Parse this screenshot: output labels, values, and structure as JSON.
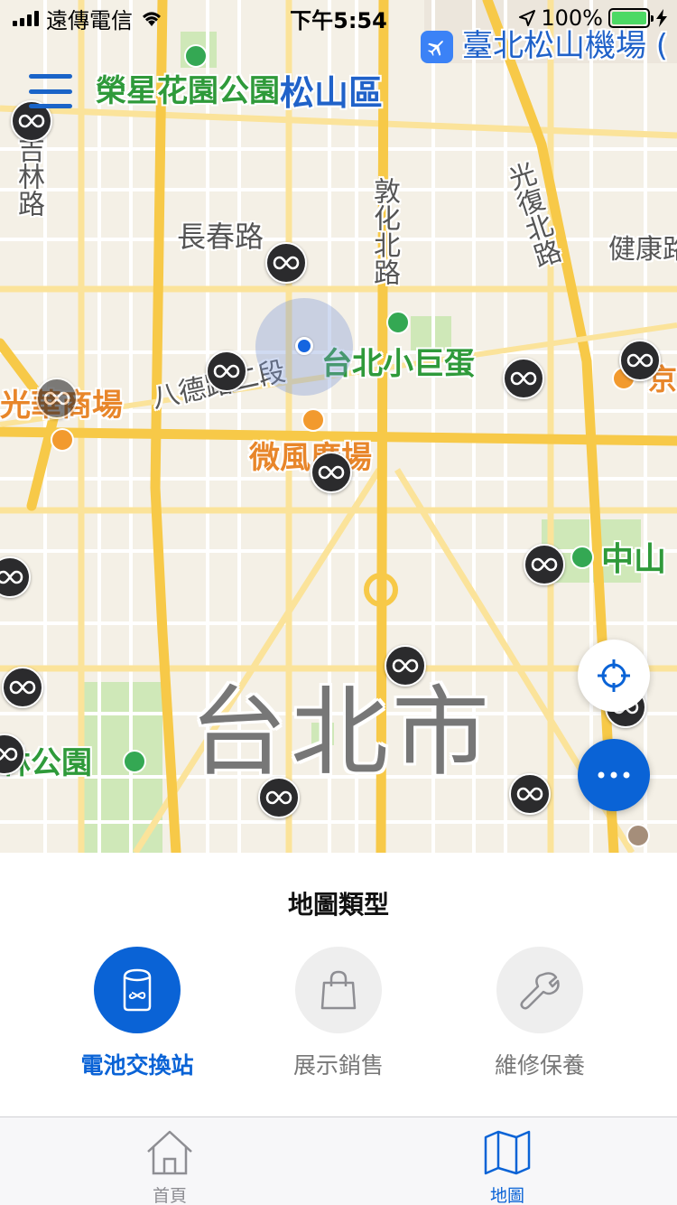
{
  "status_bar": {
    "carrier": "遠傳電信",
    "time": "下午5:54",
    "battery": "100%",
    "battery_level": 1.0
  },
  "map": {
    "airport_label": "臺北松山機場 (",
    "labels": {
      "rongxing_park": "榮星花園公園",
      "songshan_district": "松山區",
      "jilin_road": "吉林路",
      "changchun_road": "長春路",
      "dunhua_north_road": "敦化北路",
      "guangfu_north_road": "光復北路",
      "jiankang_road": "健康路",
      "taipei_arena": "台北小巨蛋",
      "guanghua_market": "光華商場",
      "bade_road": "八德路二段",
      "breeze_plaza": "微風廣場",
      "zhongshan": "中山",
      "jing": "京",
      "forest_park": "林公園",
      "city": "台北市"
    },
    "station_count": 16
  },
  "panel": {
    "title": "地圖類型",
    "options": [
      {
        "label": "電池交換站",
        "icon": "battery-icon",
        "active": true
      },
      {
        "label": "展示銷售",
        "icon": "shopping-bag-icon",
        "active": false
      },
      {
        "label": "維修保養",
        "icon": "wrench-icon",
        "active": false
      }
    ]
  },
  "tab_bar": {
    "tabs": [
      {
        "label": "首頁",
        "icon": "home-icon",
        "active": false
      },
      {
        "label": "地圖",
        "icon": "map-icon",
        "active": true
      }
    ]
  },
  "colors": {
    "accent": "#0a63d6",
    "road_major": "#f7c948",
    "map_background": "#f4f0e6",
    "park": "#cfe8b8",
    "station_marker": "#2b2b2d"
  }
}
